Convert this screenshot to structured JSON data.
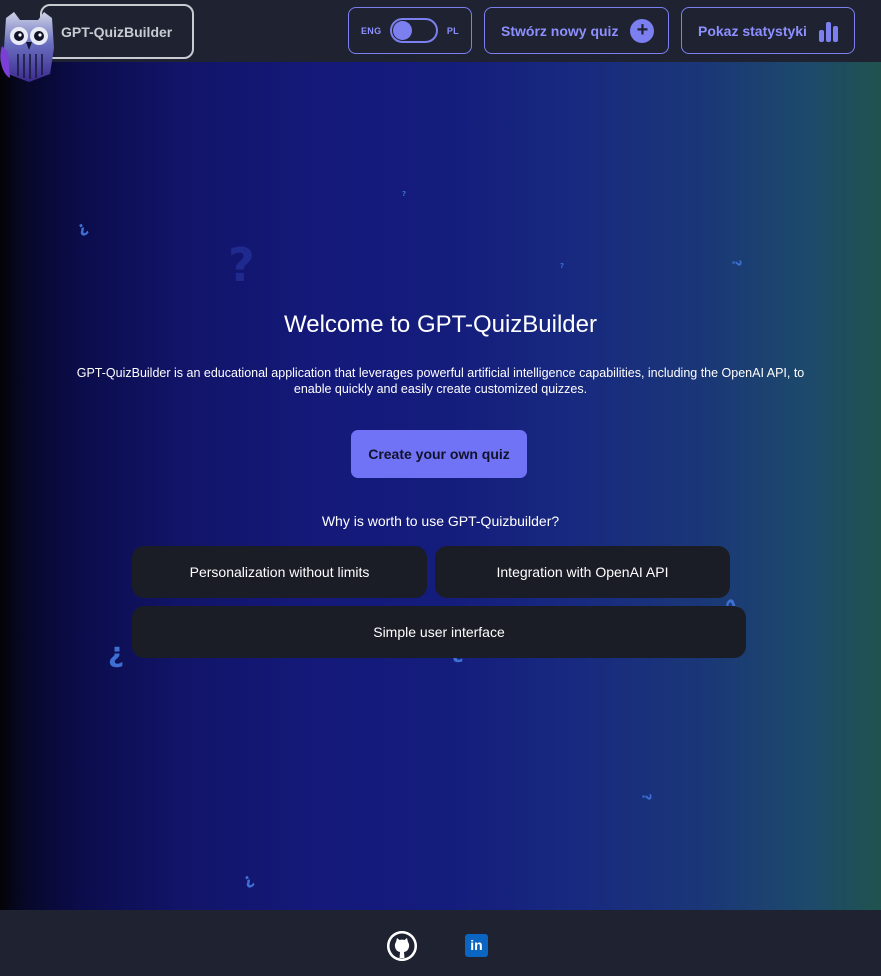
{
  "header": {
    "brand_label": "GPT-QuizBuilder",
    "language": {
      "left_label": "ENG",
      "right_label": "PL"
    },
    "create_quiz_label": "Stwórz nowy quiz",
    "stats_label": "Pokaz statystyki"
  },
  "main": {
    "title": "Welcome to GPT-QuizBuilder",
    "description": "GPT-QuizBuilder is an educational application that leverages powerful artificial intelligence capabilities, including the OpenAI API, to enable quickly and easily create customized quizzes.",
    "cta_label": "Create your own quiz",
    "why_heading": "Why is worth to use GPT-Quizbuilder?",
    "features": [
      "Personalization without limits",
      "Integration with OpenAI API",
      "Simple user interface"
    ]
  },
  "footer": {
    "links": [
      "github-icon",
      "linkedin-icon"
    ],
    "linkedin_text": "in"
  },
  "colors": {
    "accent": "#7b7ff0",
    "cta": "#7173f7",
    "header_bg": "#1f2230",
    "card_bg": "#1b1d26"
  }
}
